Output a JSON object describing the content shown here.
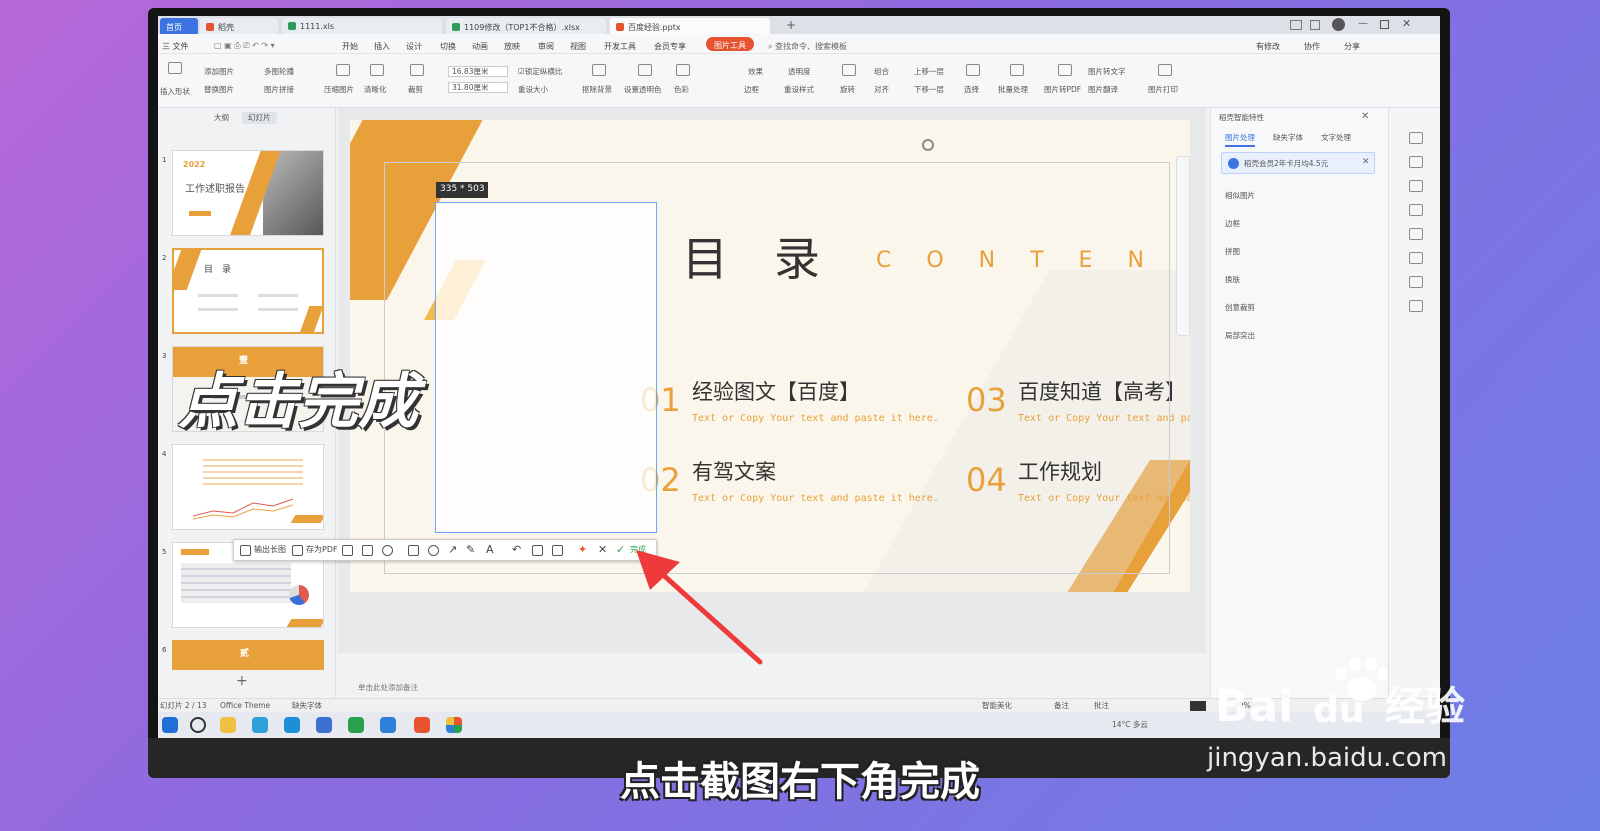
{
  "tabs": {
    "home": "首页",
    "daoke": "稻壳",
    "xls1": "1111.xls",
    "xls2": "1109修改（TOP1不合格）.xlsx",
    "pptx": "百度经验.pptx",
    "add": "+"
  },
  "menu": {
    "file": "三 文件",
    "items": [
      "开始",
      "插入",
      "设计",
      "切换",
      "动画",
      "放映",
      "审阅",
      "视图",
      "开发工具",
      "会员专享"
    ],
    "picture_tools": "图片工具",
    "search": "查找命令、搜索模板",
    "right": [
      "有修改",
      "协作",
      "分享"
    ]
  },
  "ribbon": {
    "insert_shape": "插入形状",
    "add_pic": "添加图片",
    "replace_pic": "替换图片",
    "multi_pic": "多图轮播",
    "pic_collage": "图片拼接",
    "compress": "压缩图片",
    "clarity": "清晰化",
    "crop": "裁剪",
    "width": "16.83厘米",
    "height": "31.80厘米",
    "lock_ratio": "锁定纵横比",
    "reset_size": "重设大小",
    "remove_bg": "抠除背景",
    "set_transparent": "设置透明色",
    "color": "色彩",
    "effect": "效果",
    "transparency": "透明度",
    "border": "边框",
    "reset_style": "重设样式",
    "rotate": "旋转",
    "group": "组合",
    "align": "对齐",
    "up_layer": "上移一层",
    "down_layer": "下移一层",
    "select": "选择",
    "batch": "批量处理",
    "to_pdf": "图片转PDF",
    "to_text": "图片转文字",
    "translate": "图片翻译",
    "print": "图片打印"
  },
  "left_panel": {
    "tab_outline": "大纲",
    "tab_slides": "幻灯片",
    "nums": [
      "1",
      "2",
      "3",
      "4",
      "5",
      "6"
    ],
    "t1_title": "工作述职报告",
    "t1_year": "2022",
    "t2_title": "目　录",
    "t3_badge": "壹",
    "t6_badge": "贰",
    "add": "+"
  },
  "slide": {
    "title": "目　录",
    "subtitle": "C O N T E N T",
    "items": [
      {
        "num": "01",
        "title": "经验图文【百度】",
        "desc": "Text or Copy Your text and  paste it here."
      },
      {
        "num": "03",
        "title": "百度知道【高考】",
        "desc": "Text or Copy Your text and  paste it here."
      },
      {
        "num": "02",
        "title": "有驾文案",
        "desc": "Text or Copy Your text and  paste it here."
      },
      {
        "num": "04",
        "title": "工作规划",
        "desc": "Text or Copy Your text and  paste it here."
      }
    ]
  },
  "capture": {
    "size": "335 * 503",
    "export_long": "输出长图",
    "save_pdf": "存为PDF",
    "done": "完成"
  },
  "notes": "单击此处添加备注",
  "right_panel": {
    "title": "稻壳智能特性",
    "tabs": [
      "图片处理",
      "缺失字体",
      "文字处理"
    ],
    "banner": "稻壳会员2年卡月均4.5元",
    "items": [
      "相似图片",
      "边框",
      "拼图",
      "换肤",
      "创意裁剪",
      "局部突出"
    ]
  },
  "status": {
    "slide": "幻灯片 2 / 13",
    "theme": "Office Theme",
    "font": "缺失字体",
    "beautify": "智能美化",
    "note": "备注",
    "comment": "批注",
    "zoom": "99%"
  },
  "taskbar": {
    "weather": "14°C 多云"
  },
  "overlay": {
    "title": "点击完成",
    "caption": "点击截图右下角完成"
  },
  "watermark": {
    "brand": "Bai",
    "brand2": "经验",
    "url": "jingyan.baidu.com"
  },
  "colors": {
    "accent": "#e8a13a",
    "wps_red": "#e5532f"
  }
}
